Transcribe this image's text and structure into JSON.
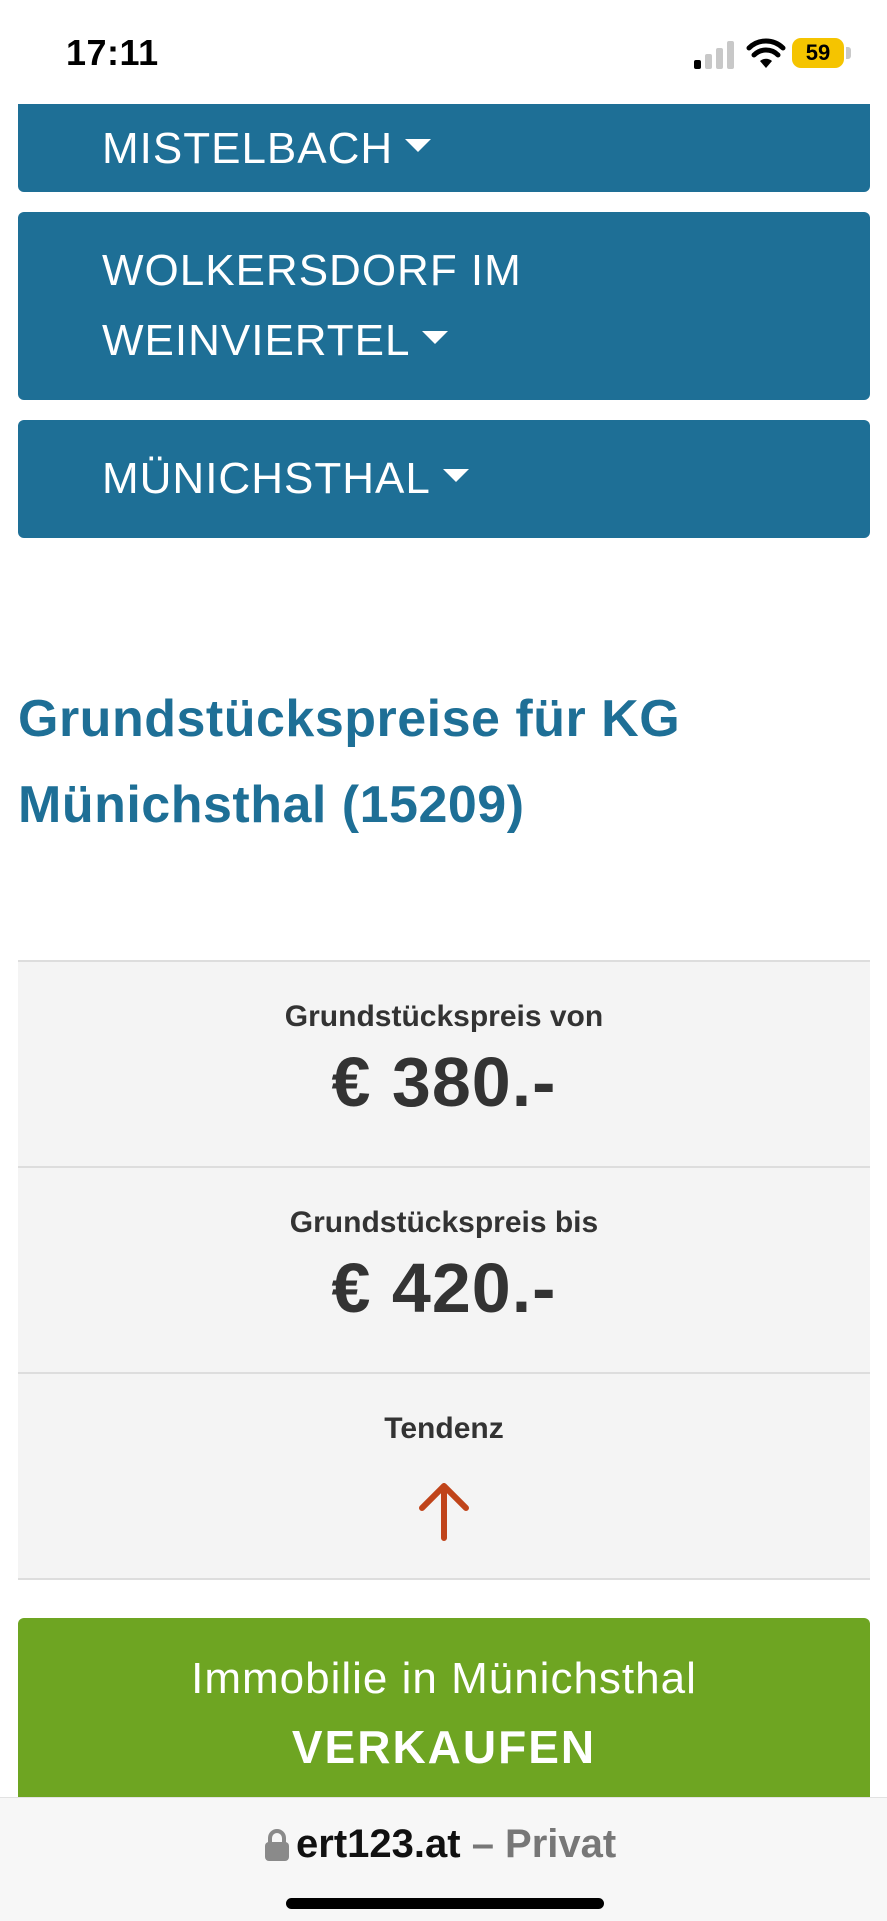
{
  "status_bar": {
    "time": "17:11",
    "battery": "59",
    "battery_color": "#f5c400",
    "icons": [
      "signal-icon",
      "wifi-icon",
      "battery-charging-icon"
    ]
  },
  "regions": [
    {
      "label": "MISTELBACH",
      "icon": "caret-down-icon"
    },
    {
      "label_line1": "WOLKERSDORF IM",
      "label_line2": "WEINVIERTEL",
      "icon": "caret-down-icon"
    },
    {
      "label": "MÜNICHSTHAL",
      "icon": "caret-down-icon"
    }
  ],
  "heading": {
    "line1": "Grundstückspreise für KG",
    "line2": "Münichsthal (15209)"
  },
  "prices": {
    "from_label": "Grundstückspreis von",
    "from_value": "€ 380.-",
    "to_label": "Grundstückspreis bis",
    "to_value": "€ 420.-",
    "tendency_label": "Tendenz",
    "tendency_icon": "arrow-up-icon",
    "tendency_color": "#c0441a"
  },
  "sell_button": {
    "line1": "Immobilie in Münichsthal",
    "line2": "VERKAUFEN"
  },
  "browser": {
    "url": "ert123.at",
    "mode": "– Privat",
    "icon": "lock-icon"
  },
  "colors": {
    "primary": "#1e6f96",
    "sell": "#6ea522",
    "table_bg": "#f4f4f4"
  }
}
